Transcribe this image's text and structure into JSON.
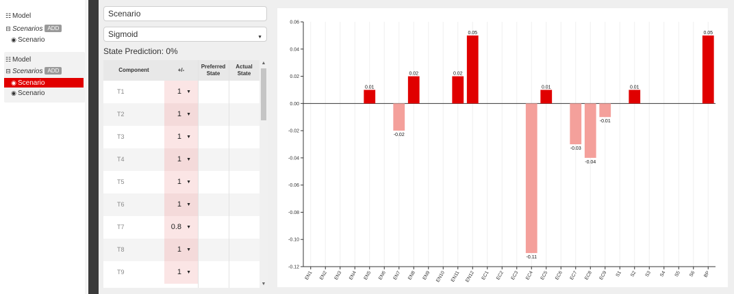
{
  "tree": {
    "group1": {
      "model_label": "Model",
      "scenarios_label": "Scenarios",
      "add_label": "ADD",
      "scenario_label": "Scenario"
    },
    "group2": {
      "model_label": "Model",
      "scenarios_label": "Scenarios",
      "add_label": "ADD",
      "scenario_selected_label": "Scenario",
      "scenario_label": "Scenario"
    }
  },
  "form": {
    "scenario_name": "Scenario",
    "function_select": "Sigmoid",
    "state_prediction": "State Prediction: 0%"
  },
  "table": {
    "headers": {
      "component": "Component",
      "plusminus": "+/-",
      "preferred": "Preferred State",
      "actual": "Actual State"
    },
    "rows": [
      {
        "component": "T1",
        "value": "1"
      },
      {
        "component": "T2",
        "value": "1"
      },
      {
        "component": "T3",
        "value": "1"
      },
      {
        "component": "T4",
        "value": "1"
      },
      {
        "component": "T5",
        "value": "1"
      },
      {
        "component": "T6",
        "value": "1"
      },
      {
        "component": "T7",
        "value": "0.8"
      },
      {
        "component": "T8",
        "value": "1"
      },
      {
        "component": "T9",
        "value": "1"
      }
    ]
  },
  "colors": {
    "selected": "#e10000",
    "bar_positive": "#e00000",
    "bar_negative": "#f4a09b"
  },
  "chart_data": {
    "type": "bar",
    "categories": [
      "EN1",
      "EN2",
      "EN3",
      "EN4",
      "EN5",
      "EN6",
      "EN7",
      "EN8",
      "EN9",
      "EN10",
      "EN11",
      "EN12",
      "EC1",
      "EC2",
      "EC3",
      "EC4",
      "EC5",
      "EC6",
      "EC7",
      "EC8",
      "EC9",
      "S1",
      "S2",
      "S3",
      "S4",
      "S5",
      "S6",
      "BP"
    ],
    "values": [
      0,
      0,
      0,
      0,
      0.01,
      0,
      -0.02,
      0.02,
      0,
      0,
      0.02,
      0.05,
      0,
      0,
      0,
      -0.11,
      0.01,
      0,
      -0.03,
      -0.04,
      -0.01,
      0,
      0.01,
      0,
      0,
      0,
      0,
      0.05
    ],
    "data_labels": [
      "",
      "",
      "",
      "",
      "0.01",
      "",
      "-0.02",
      "0.02",
      "",
      "",
      "0.02",
      "0.05",
      "",
      "",
      "",
      "-0.11",
      "0.01",
      "",
      "-0.03",
      "-0.04",
      "-0.01",
      "",
      "0.01",
      "",
      "",
      "",
      "",
      "0.05"
    ],
    "yticks": [
      "0.06",
      "0.04",
      "0.02",
      "0.00",
      "-0.02",
      "-0.04",
      "-0.06",
      "-0.08",
      "-0.10",
      "-0.12"
    ],
    "ylim": [
      -0.12,
      0.06
    ],
    "grid": "vertical",
    "title": "",
    "xlabel": "",
    "ylabel": ""
  }
}
